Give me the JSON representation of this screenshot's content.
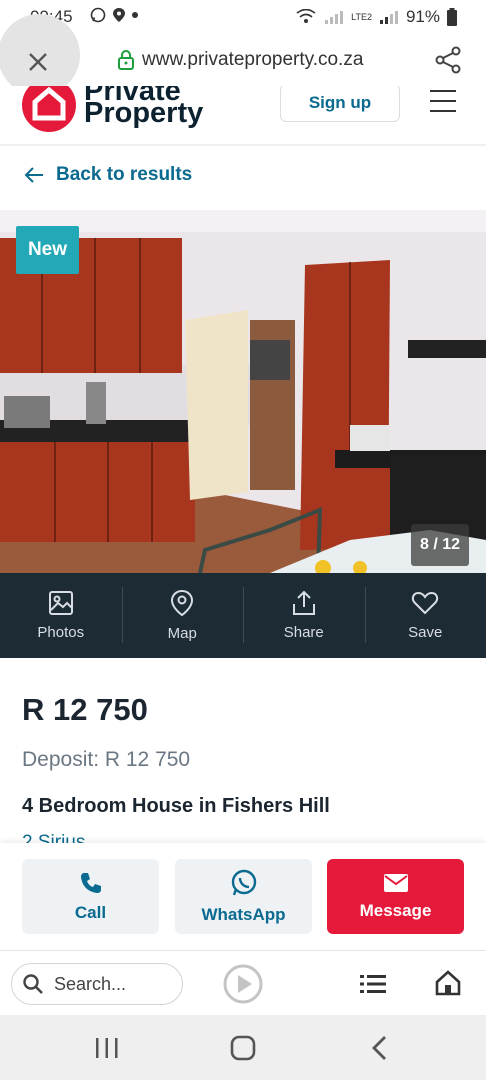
{
  "status_bar": {
    "time": "09:45",
    "battery": "91%",
    "network": "LTE2"
  },
  "browser": {
    "url": "www.privateproperty.co.za",
    "close_icon": "close-icon",
    "share_icon": "share-icon",
    "search_placeholder": "Search..."
  },
  "site_header": {
    "logo_line1": "Private",
    "logo_line2": "Property",
    "signup_label": "Sign up"
  },
  "back_label": "Back to results",
  "photo": {
    "badge": "New",
    "counter": "8 / 12"
  },
  "actions": [
    {
      "label": "Photos",
      "icon": "photos-icon"
    },
    {
      "label": "Map",
      "icon": "map-pin-icon"
    },
    {
      "label": "Share",
      "icon": "share-upload-icon"
    },
    {
      "label": "Save",
      "icon": "heart-icon"
    }
  ],
  "listing": {
    "price": "R 12 750",
    "deposit": "Deposit: R 12 750",
    "title": "4 Bedroom House in Fishers Hill",
    "address": "2 Sirius"
  },
  "contact": {
    "call_label": "Call",
    "whatsapp_label": "WhatsApp",
    "message_label": "Message"
  },
  "colors": {
    "brand_red": "#e5193a",
    "teal_link": "#0a6a8f",
    "dark_bar": "#1d2b35",
    "badge_teal": "#22a8b6"
  }
}
